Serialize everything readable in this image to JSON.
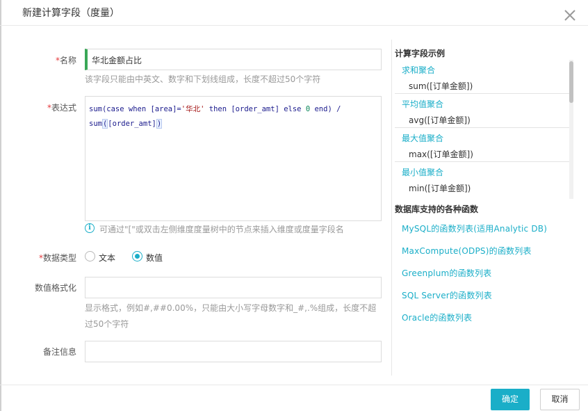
{
  "dialog": {
    "title": "新建计算字段（度量）"
  },
  "form": {
    "name": {
      "required_mark": "*",
      "label": "名称",
      "value": "华北金额占比",
      "hint": "该字段只能由中英文、数字和下划线组成，长度不超过50个字符"
    },
    "expression": {
      "required_mark": "*",
      "label": "表达式",
      "code_line1": {
        "p1": "sum(case when [area]=",
        "str": "'华北'",
        "p2": " then [order_amt] else ",
        "num": "0",
        "p3": " end) /"
      },
      "code_line2": {
        "p1": "sum",
        "p2": "(",
        "p3": "[order_amt]",
        "p4": ")"
      },
      "info_icon": "i",
      "hint": "可通过\"[\"或双击左侧维度度量树中的节点来插入维度或度量字段名"
    },
    "data_type": {
      "required_mark": "*",
      "label": "数据类型",
      "options": [
        "文本",
        "数值"
      ],
      "selected": "数值"
    },
    "number_format": {
      "label": "数值格式化",
      "value": "",
      "hint_line1": "显示格式，例如#,##0.00%，只能由大小写字母数字和_#,.%组成，长度不超",
      "hint_line2": "过50个字符"
    },
    "remark": {
      "label": "备注信息",
      "value": ""
    }
  },
  "side_panel": {
    "examples_title": "计算字段示例",
    "examples": [
      {
        "name": "求和聚合",
        "code": "sum([订单金额])"
      },
      {
        "name": "平均值聚合",
        "code": "avg([订单金额])"
      },
      {
        "name": "最大值聚合",
        "code": "max([订单金额])"
      },
      {
        "name": "最小值聚合",
        "code": "min([订单金额])"
      }
    ],
    "functions_title": "数据库支持的各种函数",
    "function_links": [
      "MySQL的函数列表(适用Analytic DB)",
      "MaxCompute(ODPS)的函数列表",
      "Greenplum的函数列表",
      "SQL Server的函数列表",
      "Oracle的函数列表"
    ]
  },
  "footer": {
    "ok_label": "确定",
    "cancel_label": "取消"
  },
  "colors": {
    "accent": "#1aaec8",
    "required": "#e4393c",
    "name_marker": "#3aa757"
  }
}
